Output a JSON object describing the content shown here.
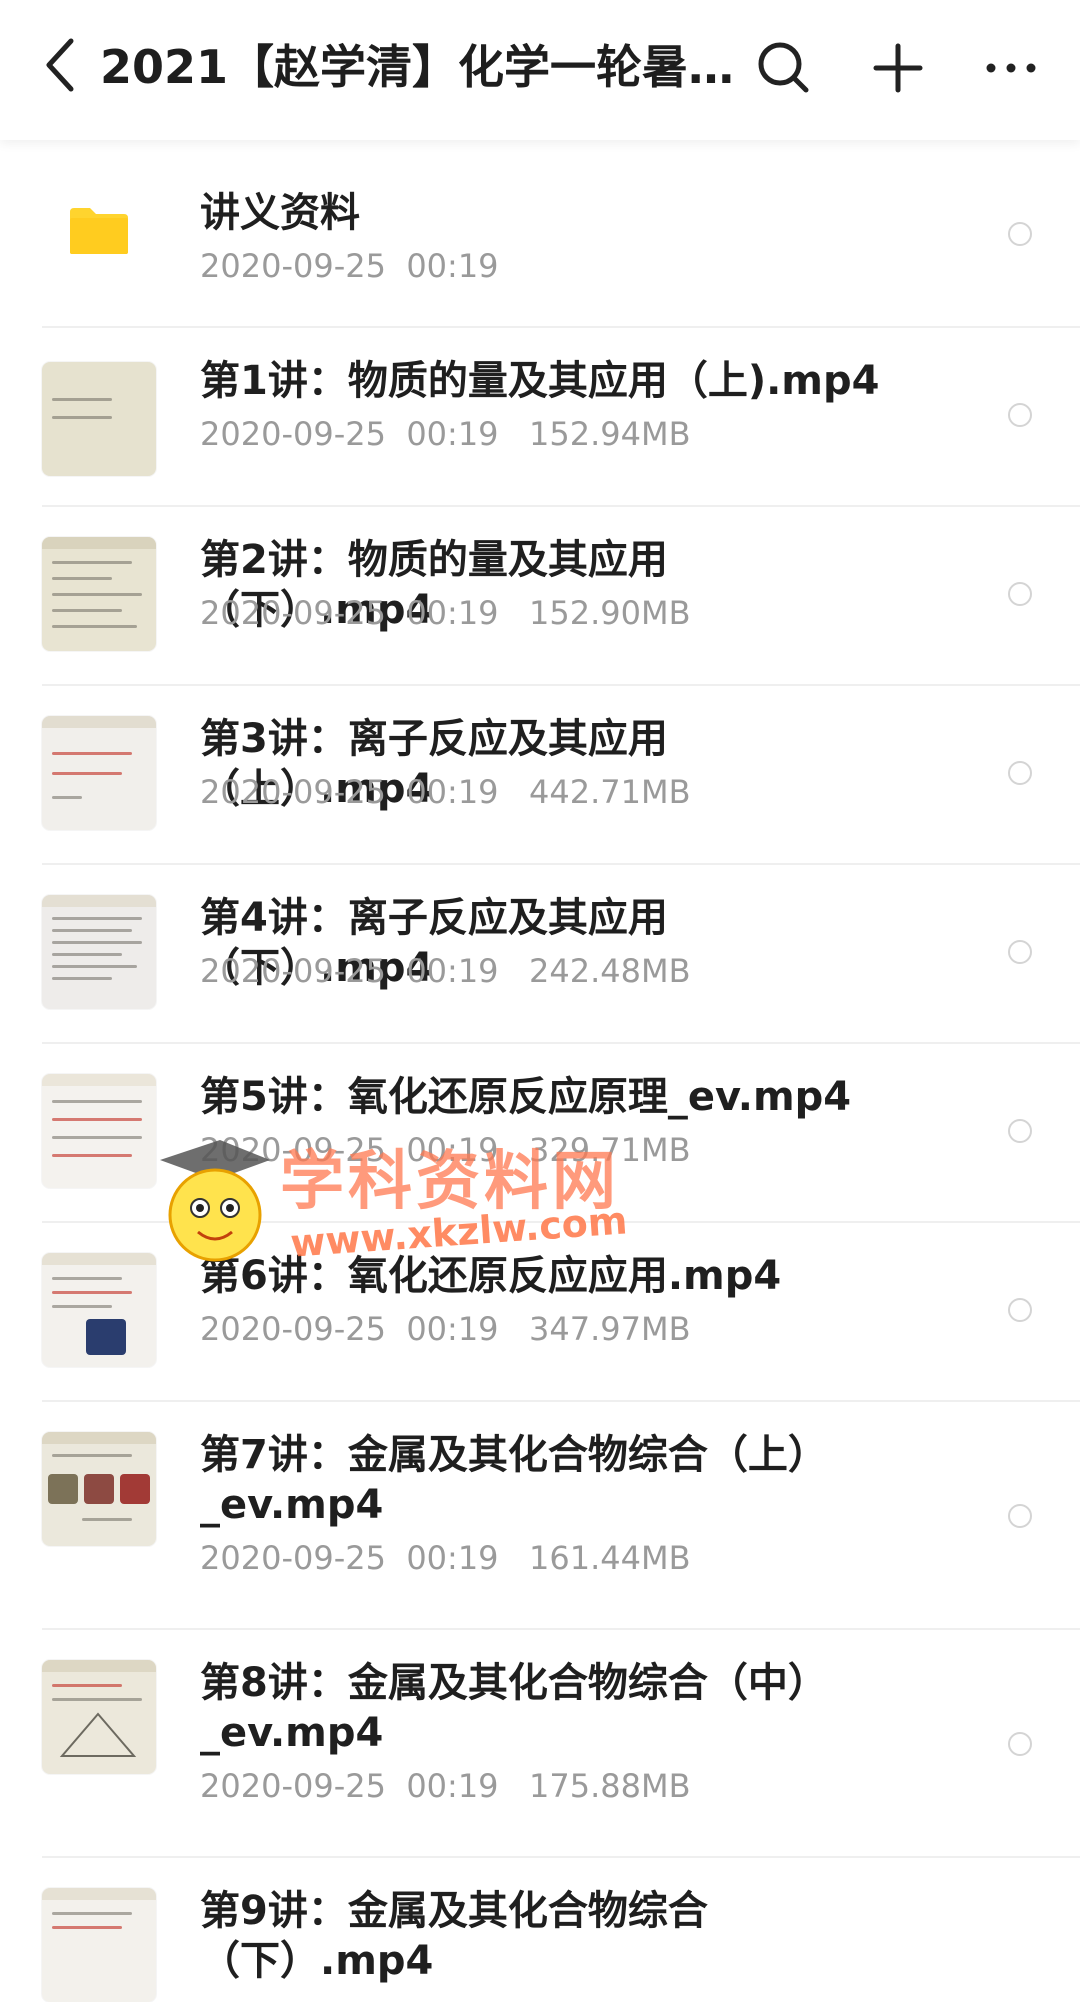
{
  "header": {
    "title": "2021【赵学清】化学一轮暑...",
    "back_icon": "chevron-left-icon",
    "search_icon": "search-icon",
    "add_icon": "plus-icon",
    "more_icon": "more-horizontal-icon"
  },
  "files": [
    {
      "name": "讲义资料",
      "date": "2020-09-25  00:19",
      "size": "",
      "type": "folder"
    },
    {
      "name": "第1讲：物质的量及其应用（上).mp4",
      "date": "2020-09-25  00:19",
      "size": "152.94MB",
      "type": "video"
    },
    {
      "name": "第2讲：物质的量及其应用（下）.mp4",
      "date": "2020-09-25  00:19",
      "size": "152.90MB",
      "type": "video"
    },
    {
      "name": "第3讲：离子反应及其应用（上）.mp4",
      "date": "2020-09-25  00:19",
      "size": "442.71MB",
      "type": "video"
    },
    {
      "name": "第4讲：离子反应及其应用（下）.mp4",
      "date": "2020-09-25  00:19",
      "size": "242.48MB",
      "type": "video"
    },
    {
      "name": "第5讲：氧化还原反应原理_ev.mp4",
      "date": "2020-09-25  00:19",
      "size": "329.71MB",
      "type": "video"
    },
    {
      "name": "第6讲：氧化还原反应应用.mp4",
      "date": "2020-09-25  00:19",
      "size": "347.97MB",
      "type": "video"
    },
    {
      "name": "第7讲：金属及其化合物综合（上）_ev.mp4",
      "date": "2020-09-25  00:19",
      "size": "161.44MB",
      "type": "video"
    },
    {
      "name": "第8讲：金属及其化合物综合（中）_ev.mp4",
      "date": "2020-09-25  00:19",
      "size": "175.88MB",
      "type": "video"
    },
    {
      "name": "第9讲：金属及其化合物综合（下）.mp4",
      "date": "",
      "size": "",
      "type": "video"
    }
  ],
  "watermark": {
    "text": "学科资料网",
    "url": "www.xkzlw.com"
  },
  "colors": {
    "folder": "#FFD42E",
    "title": "#1e1e1e",
    "meta": "#9a9a9a"
  }
}
